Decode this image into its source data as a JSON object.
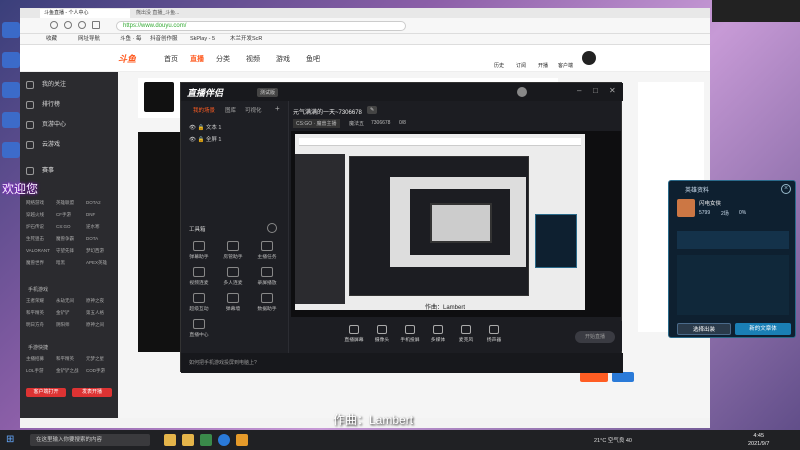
{
  "browser": {
    "url": "https://www.douyu.com/",
    "tabs": [
      "斗鱼直播 - 个人中心",
      "熊出没 直播_斗鱼..."
    ],
    "bookmarks": [
      "收藏",
      "网址导航",
      "斗鱼 · 每",
      "抖音创作服",
      "SkPlay - 5",
      "木兰开发ScR"
    ]
  },
  "site": {
    "logo": "斗鱼",
    "nav": [
      "首页",
      "直播",
      "分类",
      "视频",
      "游戏",
      "鱼吧"
    ],
    "top_icons": [
      "历史",
      "订阅",
      "开播",
      "客户端"
    ]
  },
  "sidebar": {
    "items": [
      "我的关注",
      "排行榜",
      "页游中心",
      "云游戏"
    ],
    "section_games": "赛事",
    "grid1": [
      "网络游戏",
      "英雄联盟",
      "DOTA2",
      "穿越火线",
      "CF手游",
      "DNF",
      "炉石传说",
      "CS:GO",
      "逆水寒",
      "生死狙击",
      "魔兽争霸",
      "DOTA",
      "VALORANT",
      "守望先锋",
      "梦幻西游",
      "魔兽世界",
      "暗黑",
      "APEX英雄"
    ],
    "section_mobile": "手机游戏",
    "grid2": [
      "王者荣耀",
      "永劫无间",
      "原神之夜",
      "和平精英",
      "金铲铲",
      "第五人格",
      "明日方舟",
      "阴阳师",
      "原神之间"
    ],
    "section_tech": "手游快捷",
    "grid3": [
      "主播招募",
      "和平精英",
      "元梦之星",
      "LOL手游",
      "金铲铲之战",
      "COD手游"
    ],
    "btn_client": "客户端打开",
    "btn_record": "发表开播"
  },
  "obs": {
    "title": "直播伴侣",
    "badge": "测试版",
    "tabs": [
      "我的场景",
      "图库",
      "可视化"
    ],
    "scenes": [
      "文本 1",
      "全屏 1"
    ],
    "room_title": "元气满满的一天~7306678",
    "room_tag": "CS:GO · 魔兽主播",
    "room_user": "魔法五",
    "room_id": "7306678",
    "room_count": "0/8",
    "toolbox": "工具箱",
    "tools": [
      "弹幕助手",
      "房管助手",
      "主播任务",
      "视频连麦",
      "多人连麦",
      "录屏播放",
      "超级互动",
      "弹幕墙",
      "数据助手",
      "直播中心"
    ],
    "bottom": [
      "直播屏幕",
      "摄像头",
      "手机投屏",
      "多媒体",
      "麦克风",
      "扬声器"
    ],
    "start_btn": "开始直播",
    "footer": "如何把手机游戏投屏到电脑上?",
    "preview_caption": "作曲：Lambert"
  },
  "hero_panel": {
    "title": "英雄资料",
    "name": "闪电女侠",
    "stats": [
      "5799",
      "2场",
      "0%"
    ],
    "btn_select": "选择出装",
    "btn_new": "新的文章体"
  },
  "caption": "作曲：Lambert",
  "watermark": "欢迎您",
  "taskbar": {
    "search": "在这里输入你要搜索的内容",
    "weather": "21°C 空气良 40",
    "time": "4:45",
    "date": "2021/9/7"
  },
  "colors": {
    "accent": "#ff5d23",
    "obs_bg": "#1c1d22",
    "hero_bg": "#0e2030",
    "hero_btn": "#1a7fb5"
  }
}
